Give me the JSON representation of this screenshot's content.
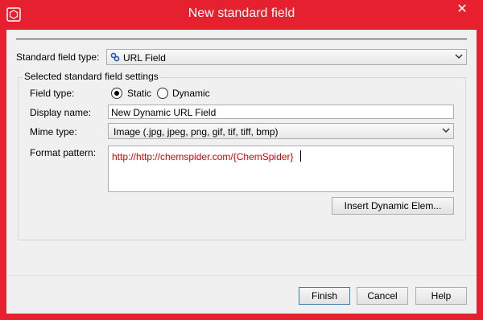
{
  "window": {
    "title": "New standard field",
    "close_glyph": "✕",
    "accent": "#e6202f"
  },
  "field_type_row": {
    "label": "Standard field type:",
    "value": "URL Field",
    "icon": "link-icon"
  },
  "settings": {
    "group_title": "Selected standard field settings",
    "field_type_label": "Field type:",
    "static_label": "Static",
    "dynamic_label": "Dynamic",
    "selected": "Static",
    "display_name_label": "Display name:",
    "display_name_value": "New Dynamic URL Field",
    "mime_type_label": "Mime type:",
    "mime_type_value": "Image (.jpg, jpeg, png, gif, tif, tiff, bmp)",
    "format_pattern_label": "Format pattern:",
    "format_pattern_value": "http://http://chemspider.com/{ChemSpider}",
    "format_pattern_color": "#e00000",
    "insert_button": "Insert Dynamic Elem..."
  },
  "buttons": {
    "finish": "Finish",
    "cancel": "Cancel",
    "help": "Help"
  }
}
